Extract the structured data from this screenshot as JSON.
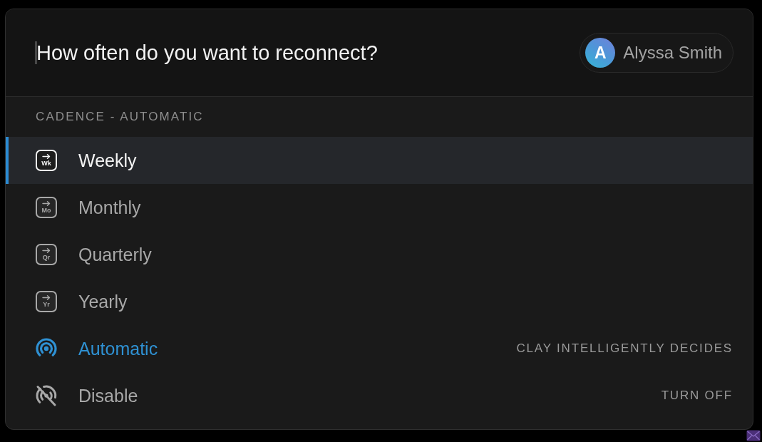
{
  "search": {
    "placeholder": "How often do you want to reconnect?",
    "focused": true
  },
  "user": {
    "initial": "A",
    "name": "Alyssa Smith"
  },
  "section": {
    "title": "CADENCE - AUTOMATIC"
  },
  "options": [
    {
      "kind": "period",
      "abbreviation": "Wk",
      "label": "Weekly",
      "selected": true,
      "active": false
    },
    {
      "kind": "period",
      "abbreviation": "Mo",
      "label": "Monthly",
      "selected": false,
      "active": false
    },
    {
      "kind": "period",
      "abbreviation": "Qr",
      "label": "Quarterly",
      "selected": false,
      "active": false
    },
    {
      "kind": "period",
      "abbreviation": "Yr",
      "label": "Yearly",
      "selected": false,
      "active": false
    },
    {
      "kind": "automatic",
      "label": "Automatic",
      "hint": "CLAY INTELLIGENTLY DECIDES",
      "selected": false,
      "active": true
    },
    {
      "kind": "disable",
      "label": "Disable",
      "hint": "TURN OFF",
      "selected": false,
      "active": false
    }
  ]
}
